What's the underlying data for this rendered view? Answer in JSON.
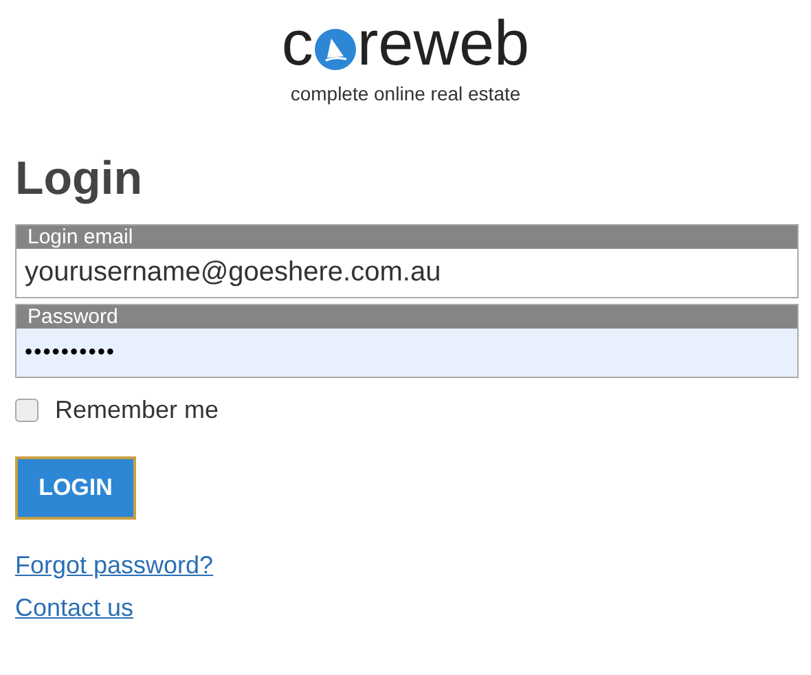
{
  "logo": {
    "text_before": "c",
    "text_after": "reweb",
    "tagline": "complete online real estate"
  },
  "title": "Login",
  "fields": [
    {
      "label": "Login email",
      "value": "yourusername@goeshere.com.au",
      "kind": "text",
      "autofilled": false
    },
    {
      "label": "Password",
      "value": "••••••••••",
      "kind": "password",
      "autofilled": true
    }
  ],
  "remember": {
    "label": "Remember me",
    "checked": false
  },
  "button": "LOGIN",
  "links": [
    "Forgot password?",
    "Contact us"
  ]
}
